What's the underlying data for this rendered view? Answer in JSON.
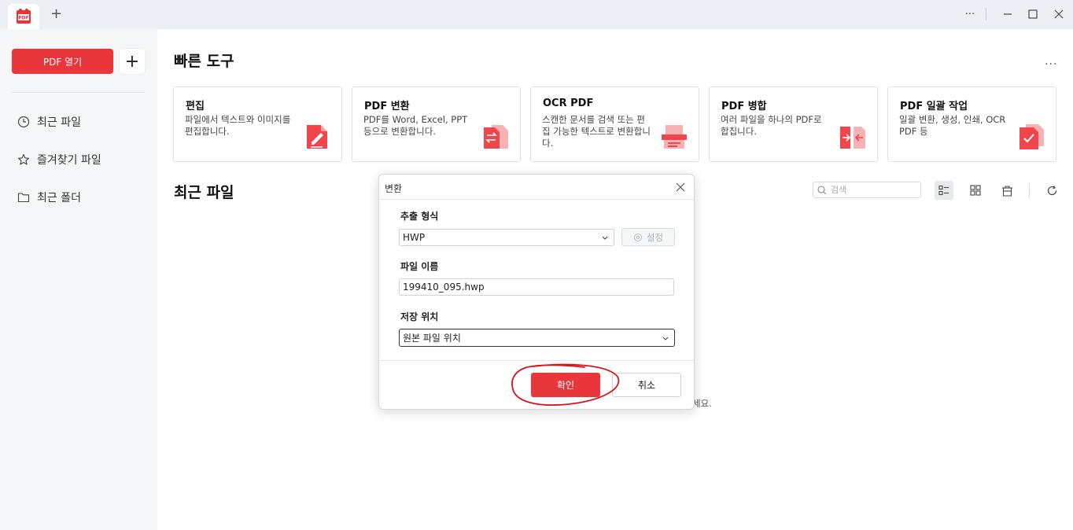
{
  "window": {
    "tab_logo_text": "PDF",
    "new_tab_label": "+",
    "more_label": "···"
  },
  "sidebar": {
    "open_pdf_label": "PDF 열기",
    "add_label": "+",
    "items": [
      {
        "label": "최근 파일",
        "icon": "clock-icon"
      },
      {
        "label": "즐겨찾기 파일",
        "icon": "star-icon"
      },
      {
        "label": "최근 폴더",
        "icon": "folder-icon"
      }
    ]
  },
  "main": {
    "quick_tools_title": "빠른 도구",
    "more_label": "···",
    "tools": [
      {
        "title": "편집",
        "desc": "파일에서 텍스트와 이미지를 편집합니다.",
        "icon": "edit-doc-icon"
      },
      {
        "title": "PDF 변환",
        "desc": "PDF를 Word, Excel, PPT 등으로 변환합니다.",
        "icon": "convert-doc-icon"
      },
      {
        "title": "OCR PDF",
        "desc": "스캔한 문서를 검색 또는 편집 가능한 텍스트로 변환합니다.",
        "icon": "ocr-scanner-icon"
      },
      {
        "title": "PDF 병합",
        "desc": "여러 파일을 하나의 PDF로 합칩니다.",
        "icon": "merge-doc-icon"
      },
      {
        "title": "PDF 일괄 작업",
        "desc": "일괄 변환, 생성, 인쇄, OCR PDF 등",
        "icon": "batch-check-icon"
      }
    ],
    "recent_title": "최근 파일",
    "search_placeholder": "검색",
    "empty_tail": "세요."
  },
  "dialog": {
    "title": "변환",
    "format_label": "추출 형식",
    "format_value": "HWP",
    "settings_label": "설정",
    "filename_label": "파일 이름",
    "filename_value": "199410_095.hwp",
    "location_label": "저장 위치",
    "location_value": "원본 파일 위치",
    "ok_label": "확인",
    "cancel_label": "취소"
  },
  "colors": {
    "accent": "#e8363b",
    "sidebar_bg": "#f5f6f8",
    "titlebar_bg": "#eceff3",
    "annotation_circle": "#d8131b"
  }
}
